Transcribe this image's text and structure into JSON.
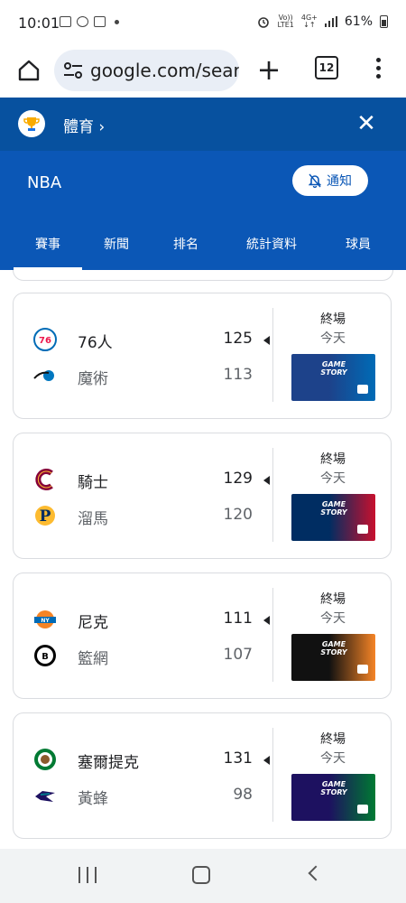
{
  "status_bar": {
    "time": "10:01",
    "net_top": "Vo))",
    "net_bottom": "LTE1",
    "gen_top": "4G+",
    "gen_bottom": "↓↑",
    "battery": "61%"
  },
  "browser": {
    "url": "google.com/search",
    "tab_count": "12"
  },
  "header": {
    "breadcrumb": "體育",
    "league": "NBA",
    "notify_label": "通知"
  },
  "tabs": [
    {
      "label": "賽事",
      "active": true
    },
    {
      "label": "新聞"
    },
    {
      "label": "排名"
    },
    {
      "label": "統計資料"
    },
    {
      "label": "球員"
    }
  ],
  "games": [
    {
      "home": {
        "name": "76人",
        "score": "125",
        "logo": "76ers-logo"
      },
      "away": {
        "name": "魔術",
        "score": "113",
        "logo": "magic-logo"
      },
      "winner": "home",
      "status": "終場",
      "date": "今天",
      "thumb_text": "GAME STORY",
      "colors": [
        "#1d428a",
        "#006bb6"
      ]
    },
    {
      "home": {
        "name": "騎士",
        "score": "129",
        "logo": "cavaliers-logo"
      },
      "away": {
        "name": "溜馬",
        "score": "120",
        "logo": "pacers-logo"
      },
      "winner": "home",
      "status": "終場",
      "date": "今天",
      "thumb_text": "GAME STORY",
      "colors": [
        "#002d62",
        "#c8102e"
      ]
    },
    {
      "home": {
        "name": "尼克",
        "score": "111",
        "logo": "knicks-logo"
      },
      "away": {
        "name": "籃網",
        "score": "107",
        "logo": "nets-logo"
      },
      "winner": "home",
      "status": "終場",
      "date": "今天",
      "thumb_text": "GAME STORY",
      "colors": [
        "#111111",
        "#f58426"
      ]
    },
    {
      "home": {
        "name": "塞爾提克",
        "score": "131",
        "logo": "celtics-logo"
      },
      "away": {
        "name": "黃蜂",
        "score": "98",
        "logo": "hornets-logo"
      },
      "winner": "home",
      "status": "終場",
      "date": "今天",
      "thumb_text": "GAME STORY",
      "colors": [
        "#1d1160",
        "#007a33"
      ]
    }
  ]
}
